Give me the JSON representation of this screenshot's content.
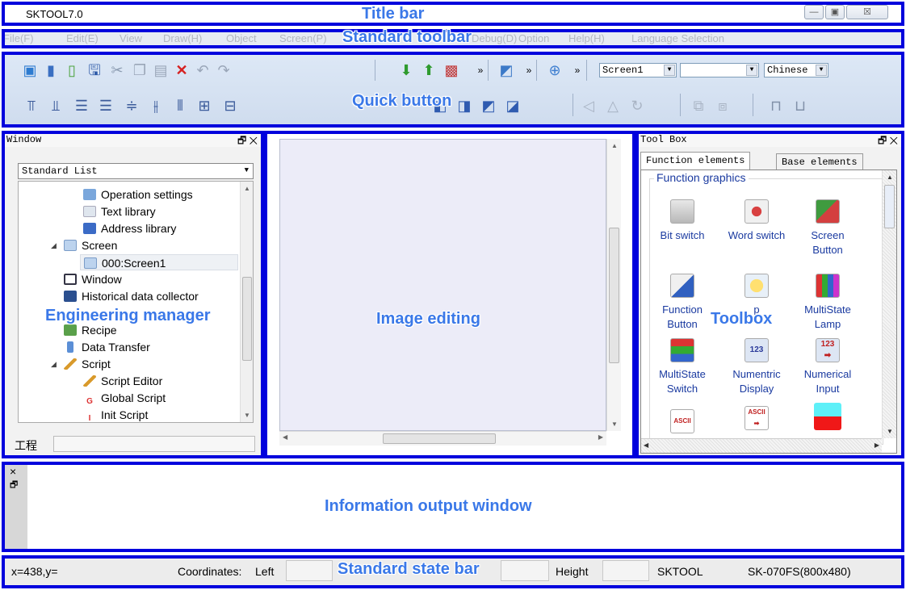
{
  "title_bar": {
    "app_title": "SKTOOL7.0",
    "minimize": "—",
    "restore": "▣",
    "close": "☒"
  },
  "menu": [
    "File(F)",
    "Edit(E)",
    "View",
    "Draw(H)",
    "Object",
    "Screen(P)",
    "Debug(D)",
    "Option",
    "Help(H)",
    "Language Selection"
  ],
  "toolbar": {
    "screen_select": "Screen1",
    "blank_select": "",
    "language_select": "Chinese",
    "overflow": "»"
  },
  "window_pane": {
    "header": "Window",
    "pin": "🗗",
    "close": "✕",
    "dropdown": "Standard List",
    "tree": [
      {
        "label": "Operation settings",
        "depth": 2,
        "icon": "gear-icon"
      },
      {
        "label": "Text library",
        "depth": 2,
        "icon": "text-icon"
      },
      {
        "label": "Address library",
        "depth": 2,
        "icon": "address-icon"
      },
      {
        "label": "Screen",
        "depth": 1,
        "icon": "screen-icon",
        "expanded": true
      },
      {
        "label": "000:Screen1",
        "depth": 2,
        "icon": "screen-icon",
        "selected": true
      },
      {
        "label": "Window",
        "depth": 1,
        "icon": "window-icon"
      },
      {
        "label": "Historical data collector",
        "depth": 1,
        "icon": "disk-icon"
      },
      {
        "label": "",
        "depth": 1,
        "icon": "blank"
      },
      {
        "label": "Recipe",
        "depth": 1,
        "icon": "recipe-icon"
      },
      {
        "label": "Data Transfer",
        "depth": 1,
        "icon": "transfer-icon"
      },
      {
        "label": "Script",
        "depth": 1,
        "icon": "pen-icon",
        "expanded": true
      },
      {
        "label": "Script Editor",
        "depth": 2,
        "icon": "pen-icon"
      },
      {
        "label": "Global Script",
        "depth": 2,
        "icon": "g-icon"
      },
      {
        "label": "Init Script",
        "depth": 2,
        "icon": "i-icon"
      }
    ],
    "bottom_tab": "工程"
  },
  "toolbox": {
    "header": "Tool Box",
    "pin": "🗗",
    "close": "✕",
    "tabs": [
      "Function elements",
      "Base elements"
    ],
    "section": "Function graphics",
    "items": [
      {
        "label": "Bit switch",
        "icon": "bit-switch-icon"
      },
      {
        "label": "Word switch",
        "icon": "word-switch-icon"
      },
      {
        "label": "Screen Button",
        "icon": "screen-button-icon"
      },
      {
        "label": "Function Button",
        "icon": "function-button-icon"
      },
      {
        "label": "p",
        "icon": "lamp-icon"
      },
      {
        "label": "MultiState Lamp",
        "icon": "multistate-lamp-icon"
      },
      {
        "label": "MultiState Switch",
        "icon": "multistate-switch-icon"
      },
      {
        "label": "Numentric Display",
        "icon": "numeric-display-icon"
      },
      {
        "label": "Numerical Input",
        "icon": "numeric-input-icon"
      },
      {
        "label": "",
        "icon": "ascii-display-icon"
      },
      {
        "label": "",
        "icon": "ascii-input-icon"
      },
      {
        "label": "",
        "icon": "color-bar-icon"
      }
    ]
  },
  "output_window": {
    "close": "×",
    "pin": "🗗"
  },
  "status_bar": {
    "cursor": "x=438,y=",
    "coordinates_label": "Coordinates:",
    "left_label": "Left",
    "height_label": "Height",
    "software": "SKTOOL",
    "device": "SK-070FS(800x480)"
  },
  "callouts": {
    "title_bar": "Title bar",
    "standard_toolbar": "Standard toolbar",
    "quick_button": "Quick button",
    "engineering_manager": "Engineering manager",
    "image_editing": "Image editing",
    "toolbox": "Toolbox",
    "information_output": "Information output window",
    "state_bar": "Standard state bar"
  },
  "colors": {
    "annotation_border": "#0000dd",
    "callout_text": "#3a78e8",
    "canvas": "#ececf8"
  }
}
